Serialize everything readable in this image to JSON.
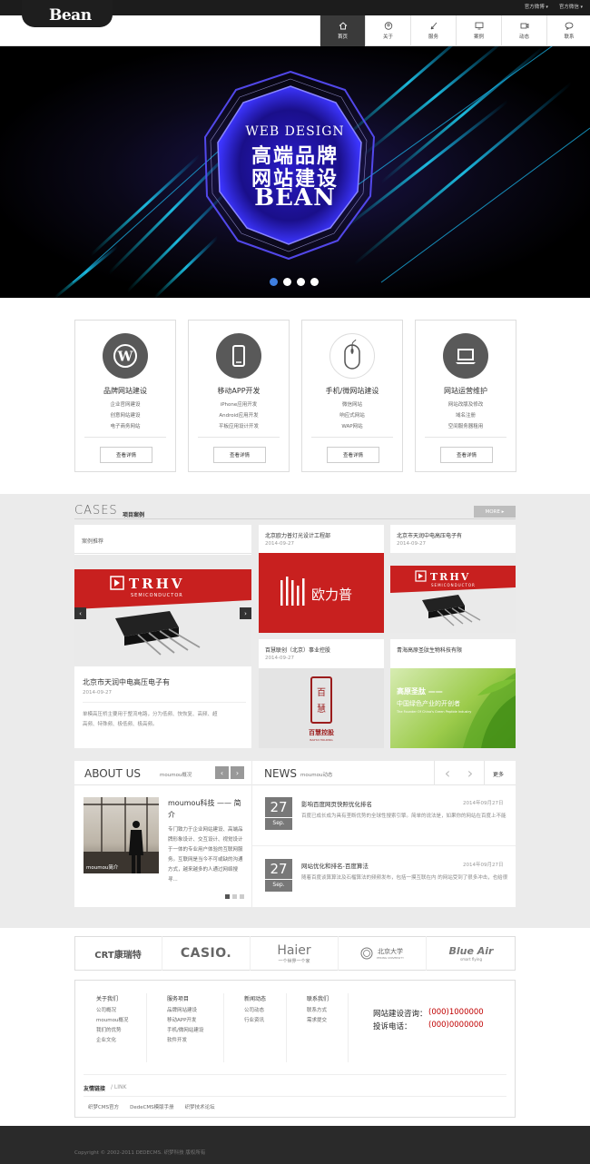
{
  "top_links": [
    "官方微博",
    "官方微信"
  ],
  "logo": "Bean",
  "nav": [
    {
      "label": "首页",
      "icon": "home-icon",
      "active": true
    },
    {
      "label": "关于",
      "icon": "user-icon",
      "active": false
    },
    {
      "label": "服务",
      "icon": "pen-icon",
      "active": false
    },
    {
      "label": "案例",
      "icon": "monitor-icon",
      "active": false
    },
    {
      "label": "动态",
      "icon": "video-icon",
      "active": false
    },
    {
      "label": "联系",
      "icon": "chat-icon",
      "active": false
    }
  ],
  "banner": {
    "line1": "WEB DESIGN",
    "line2": "高端品牌",
    "line3": "网站建设",
    "line4": "BEAN",
    "slides": 4,
    "active": 1
  },
  "services": [
    {
      "title": "品牌网站建设",
      "icon": "wordpress-icon",
      "items": [
        "企业官网建设",
        "创意网站建设",
        "电子商务网站"
      ],
      "button": "查看详情"
    },
    {
      "title": "移动APP开发",
      "icon": "phone-icon",
      "items": [
        "iPhone应用开发",
        "Android应用开发",
        "平板应用设计开发"
      ],
      "button": "查看详情"
    },
    {
      "title": "手机/微网站建设",
      "icon": "mouse-icon",
      "items": [
        "微信网站",
        "响应式网站",
        "WAP网站"
      ],
      "button": "查看详情"
    },
    {
      "title": "网站运营维护",
      "icon": "laptop-icon",
      "items": [
        "网站改版及修改",
        "域名注册",
        "空间服务器租用"
      ],
      "button": "查看详情"
    }
  ],
  "cases": {
    "title": "CASES",
    "subtitle": "项目案例",
    "more": "MORE",
    "featured": {
      "label": "案例推荐",
      "title": "北京市天润中电高压电子有",
      "date": "2014-09-27",
      "desc": "单模高压桥主要用于整流电路，分为低频、快恢复、高频、超高频、特殊频、极低频、极高频。"
    },
    "items": [
      {
        "title": "北京欧力普灯光设计工程部",
        "date": "2014-09-27",
        "logo": "欧力普"
      },
      {
        "title": "北京市天润中电高压电子有",
        "date": "2014-09-27",
        "logo": "TRHV"
      },
      {
        "title": "百慧联创（北京）事业控股",
        "date": "2014-09-27",
        "logo": "百慧控股",
        "logo_en": "BAIHUI HOLDING"
      },
      {
        "title": "青海高原圣肽生物科技有限",
        "date": "2014-09-27",
        "logo": "高原圣肽 ——",
        "tagline": "中国绿色产业的开创者",
        "tagline_en": "The Founder Of China's Green Peptide Industry"
      }
    ],
    "trhv": {
      "brand": "TRHV",
      "sub": "SEMICONDUCTOR"
    }
  },
  "about": {
    "title": "ABOUT US",
    "sub": "moumou概况",
    "heading": "moumou科技 —— 简介",
    "body": "专门致力于企业网站建设、高端品牌形象设计、交互设计、视觉设计于一体的专业用户体验的互联网服务。互联网是当今不可或缺的沟通方式，越来越多的人通过网络搜寻...",
    "caption": "moumou简介"
  },
  "news": {
    "title": "NEWS",
    "sub": "moumou动态",
    "more": "更多",
    "items": [
      {
        "day": "27",
        "month": "Sep.",
        "title": "影响百度网页快照优化排名",
        "date": "2014年09月27日",
        "desc": "百度已成长成为具有垄断优势的全球性搜索引擎。简单的说法是，如果你的网站在百度上不能"
      },
      {
        "day": "27",
        "month": "Sep.",
        "title": "网站优化和排名-百度算法",
        "date": "2014年09月27日",
        "desc": "随着百度谈算算法及石榴算法的频频发布，包括一摸互联在内 的网站受到了很多冲击，也给很"
      }
    ]
  },
  "brands": [
    {
      "name": "CRT康瑞特"
    },
    {
      "name": "CASIO."
    },
    {
      "name": "Haier",
      "sub": "一个世界一个家"
    },
    {
      "name": "北京大学",
      "sub": "PEKING UNIVERSITY"
    },
    {
      "name": "Blue Air",
      "sub": "smart flying"
    }
  ],
  "footer": {
    "cols": [
      {
        "title": "关于我们",
        "links": [
          "公司概况",
          "moumou概况",
          "我们的优势",
          "企业文化"
        ]
      },
      {
        "title": "服务项目",
        "links": [
          "品牌网站建设",
          "移动APP开发",
          "手机/微网站建设",
          "软件开发"
        ]
      },
      {
        "title": "新闻动态",
        "links": [
          "公司动态",
          "行业资讯"
        ]
      },
      {
        "title": "联系我们",
        "links": [
          "联系方式",
          "需求提交"
        ]
      }
    ],
    "consult_label": "网站建设咨询：",
    "consult_phone": "(000)1000000",
    "complain_label": "投诉电话：",
    "complain_phone": "(000)0000000",
    "links_title": "友情链接",
    "links_sub": "/ LINK",
    "friend_links": [
      "织梦CMS官方",
      "DedeCMS模版手册",
      "织梦技术论坛"
    ]
  },
  "copyright": "Copyright © 2002-2011 DEDECMS. 织梦科技 版权所有",
  "colors": {
    "accent": "#3f7fe0",
    "dark": "#1c1c1c",
    "red": "#c8201f",
    "phone": "#c00000"
  }
}
